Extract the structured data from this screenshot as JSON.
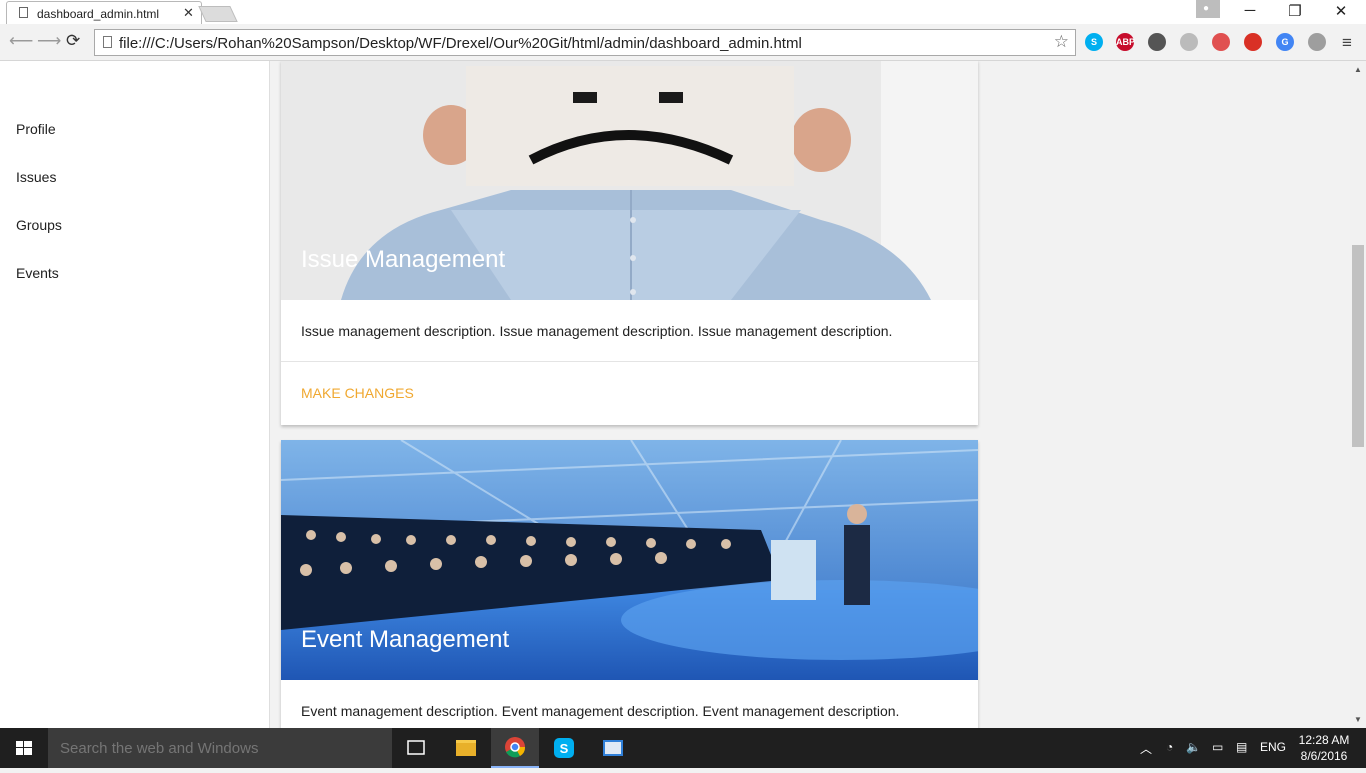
{
  "browser": {
    "tab_title": "dashboard_admin.html",
    "address": "file:///C:/Users/Rohan%20Sampson/Desktop/WF/Drexel/Our%20Git/html/admin/dashboard_admin.html",
    "extensions": [
      {
        "name": "skype-icon",
        "color": "#00aff0",
        "label": "S"
      },
      {
        "name": "adblock-plus-icon",
        "color": "#c70d2c",
        "label": "ABP"
      },
      {
        "name": "lightbulb-icon",
        "color": "#555555",
        "label": ""
      },
      {
        "name": "refresh-extension-icon",
        "color": "#bbbbbb",
        "label": ""
      },
      {
        "name": "blocked-extension-icon",
        "color": "#e05050",
        "label": ""
      },
      {
        "name": "target-extension-icon",
        "color": "#d93025",
        "label": ""
      },
      {
        "name": "google-translate-icon",
        "color": "#4285f4",
        "label": "G"
      },
      {
        "name": "www-extension-icon",
        "color": "#9e9e9e",
        "label": ""
      }
    ]
  },
  "sidebar": {
    "items": [
      {
        "label": "Profile"
      },
      {
        "label": "Issues"
      },
      {
        "label": "Groups"
      },
      {
        "label": "Events"
      }
    ]
  },
  "cards": [
    {
      "title": "Issue Management",
      "description": "Issue management description. Issue management description. Issue management description.",
      "action": "MAKE CHANGES"
    },
    {
      "title": "Event Management",
      "description": "Event management description. Event management description. Event management description."
    }
  ],
  "taskbar": {
    "search_placeholder": "Search the web and Windows",
    "language": "ENG",
    "time": "12:28 AM",
    "date": "8/6/2016"
  },
  "colors": {
    "accent": "#f0a830",
    "taskbar": "#1f1f1f"
  }
}
